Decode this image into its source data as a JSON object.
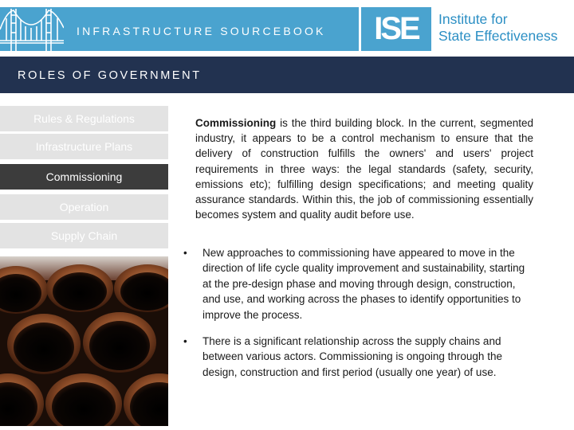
{
  "header": {
    "sourcebook_title": "INFRASTRUCTURE SOURCEBOOK",
    "logo_mark": "ISE",
    "logo_name_line1": "Institute for",
    "logo_name_line2": "State Effectiveness",
    "banner_color": "#4aa3cf"
  },
  "section": {
    "title": "ROLES OF GOVERNMENT",
    "bar_color": "#223250"
  },
  "nav": {
    "items": [
      {
        "label": "Rules & Regulations",
        "active": false
      },
      {
        "label": "Infrastructure Plans",
        "active": false
      },
      {
        "label": "Commissioning",
        "active": true
      },
      {
        "label": "Operation",
        "active": false
      },
      {
        "label": "Supply Chain",
        "active": false
      }
    ]
  },
  "content": {
    "intro_bold": "Commissioning",
    "intro_rest": " is the third building block. In the current, segmented industry, it appears to be a control mechanism to ensure that the delivery of construction fulfills the owners' and users' project requirements in three ways: the legal standards (safety, security, emissions etc); fulfilling design specifications; and meeting quality assurance standards. Within this, the job of commissioning essentially becomes system and quality audit before use.",
    "bullet_symbol": "•",
    "bullets": [
      " New approaches to commissioning have appeared to move in the direction of life cycle quality improvement and sustainability, starting at the pre-design phase and moving through design, construction, and use, and working across the phases to identify opportunities to improve the process.",
      "There is a significant relationship across the supply chains and between various actors. Commissioning is ongoing through the design, construction and first period (usually one year) of use."
    ]
  },
  "icons": {
    "bridge": "bridge-icon",
    "photo": "stacked-pipes-photo"
  }
}
